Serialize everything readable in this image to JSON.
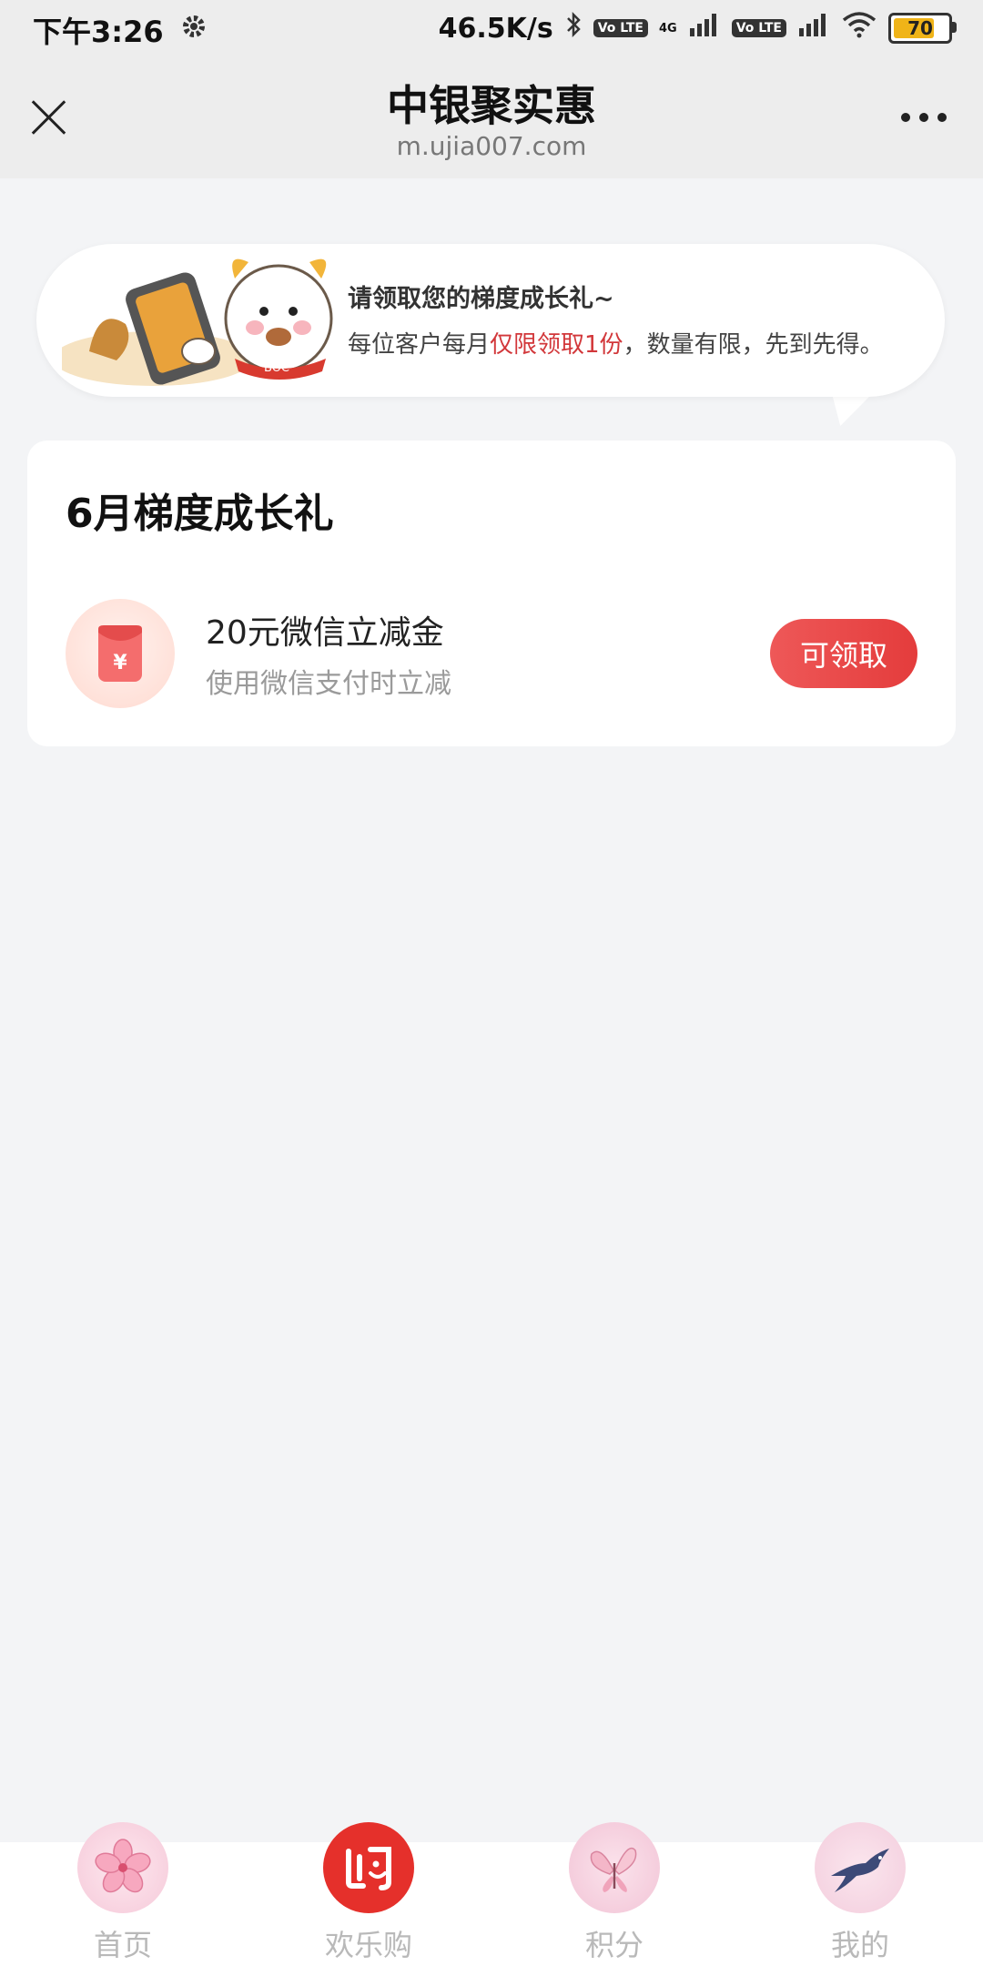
{
  "status_bar": {
    "time": "下午3:26",
    "net_speed": "46.5K/s",
    "network": "4G",
    "volte_1": "Vo LTE",
    "volte_2": "Vo LTE",
    "battery": "70"
  },
  "header": {
    "title": "中银聚实惠",
    "url": "m.ujia007.com"
  },
  "banner": {
    "title": "请领取您的梯度成长礼~",
    "sub_before": "每位客户每月",
    "sub_highlight": "仅限领取1份",
    "sub_after": "，数量有限，先到先得。",
    "mascot_badge": "BOC"
  },
  "card": {
    "title": "6月梯度成长礼",
    "coupon": {
      "name": "20元微信立减金",
      "desc": "使用微信支付时立减",
      "icon_symbol": "¥",
      "button": "可领取"
    }
  },
  "bottom_nav": {
    "items": [
      {
        "label": "首页",
        "icon": "flower-icon"
      },
      {
        "label": "欢乐购",
        "icon": "shop-logo-icon"
      },
      {
        "label": "积分",
        "icon": "butterfly-icon"
      },
      {
        "label": "我的",
        "icon": "swallow-icon"
      }
    ]
  },
  "colors": {
    "accent": "#e43c3c",
    "highlight_text": "#d2373a",
    "page_bg": "#f3f4f6",
    "nav_label": "#b9b9b9"
  }
}
